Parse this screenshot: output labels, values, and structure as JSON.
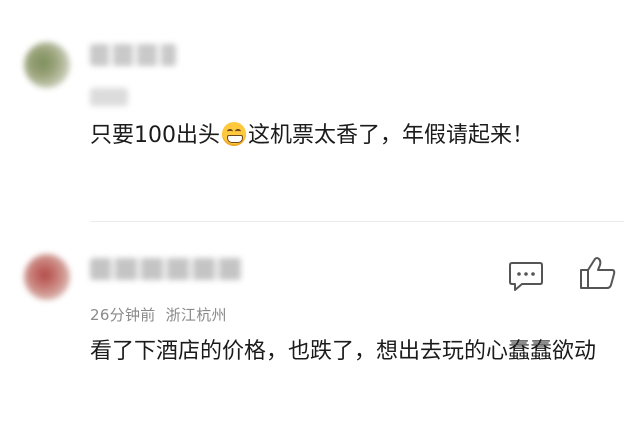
{
  "comments": [
    {
      "author": "",
      "content_before_emoji": "只要100出头",
      "emoji": "grinning-face-icon",
      "content_after_emoji": "这机票太香了，年假请起来！"
    },
    {
      "author": "",
      "time": "26分钟前",
      "location": "浙江杭州",
      "content": "看了下酒店的价格，也跌了，想出去玩的心蠢蠢欲动",
      "actions": [
        "comment-icon",
        "thumbs-up-icon"
      ]
    }
  ]
}
